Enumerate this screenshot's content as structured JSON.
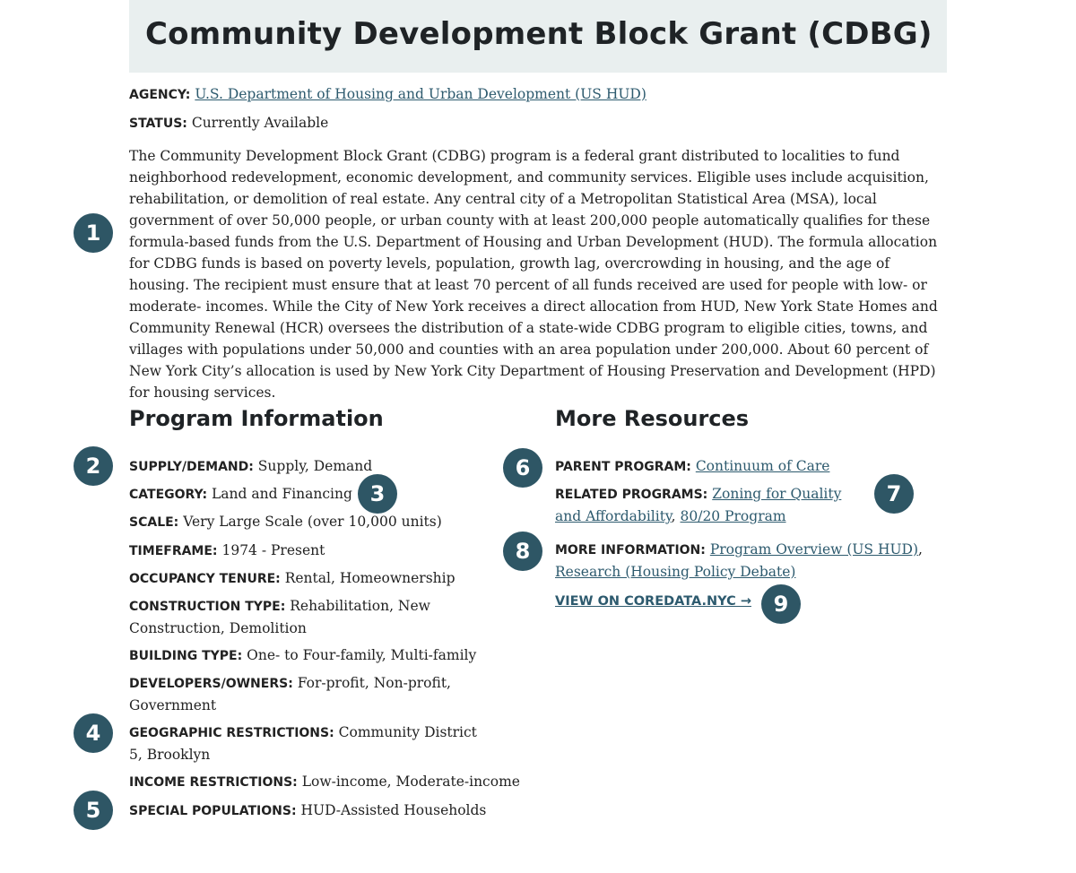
{
  "title": "Community Development Block Grant (CDBG)",
  "agency": {
    "label": "AGENCY:",
    "value": "U.S. Department of Housing and Urban Development (US HUD)"
  },
  "status": {
    "label": "STATUS:",
    "value": "Currently Available"
  },
  "description": "The Community Development Block Grant (CDBG) program is a federal grant distributed to localities to fund neighborhood redevelopment, economic development, and community services. Eligible uses include acquisition, rehabilitation, or demolition of real estate. Any central city of a Metropolitan Statistical Area (MSA), local government of over 50,000 people, or urban county with at least 200,000 people automatically qualifies for these formula-based funds from the U.S. Department of Housing and Urban Development (HUD). The formula allocation for CDBG funds is based on poverty levels, population, growth lag, overcrowding in housing, and the age of housing. The recipient must ensure that at least 70 percent of all funds received are used for people with low- or moderate- incomes. While the City of New York receives a direct allocation from HUD, New York State Homes and Community Renewal (HCR) oversees the distribution of a state-wide CDBG program to eligible cities, towns, and villages with populations under 50,000 and counties with an area population under 200,000. About 60 percent of New York City’s allocation is used by New York City Department of Housing Preservation and Development (HPD) for housing services.",
  "program_info": {
    "heading": "Program Information",
    "supply": {
      "label": "SUPPLY/DEMAND:",
      "value": "Supply, Demand"
    },
    "category": {
      "label": "CATEGORY:",
      "value": "Land and Financing"
    },
    "scale": {
      "label": "SCALE:",
      "value": "Very Large Scale (over 10,000 units)"
    },
    "timeframe": {
      "label": "TIMEFRAME:",
      "value": "1974 - Present"
    },
    "tenure": {
      "label": "OCCUPANCY TENURE:",
      "value": "Rental, Homeownership"
    },
    "construction": {
      "label": "CONSTRUCTION TYPE:",
      "value": "Rehabilitation, New Construction, Demolition"
    },
    "building": {
      "label": "BUILDING TYPE:",
      "value": "One- to Four-family, Multi-family"
    },
    "developers": {
      "label": "DEVELOPERS/OWNERS:",
      "value": "For-profit, Non-profit, Government"
    },
    "geographic": {
      "label": "GEOGRAPHIC RESTRICTIONS:",
      "value": "Community District 5, Brooklyn"
    },
    "income": {
      "label": "INCOME RESTRICTIONS:",
      "value": "Low-income, Moderate-income"
    },
    "special": {
      "label": "SPECIAL POPULATIONS:",
      "value": "HUD-Assisted Households"
    }
  },
  "resources": {
    "heading": "More Resources",
    "parent": {
      "label": "PARENT PROGRAM:",
      "link": "Continuum of Care"
    },
    "related": {
      "label": "RELATED PROGRAMS:",
      "link1": "Zoning for Quality and Affordability",
      "sep": ", ",
      "link2": "80/20 Program"
    },
    "more_info": {
      "label": "MORE INFORMATION:",
      "link1": "Program Overview (US HUD)",
      "sep": ", ",
      "link2": "Research (Housing Policy Debate)"
    },
    "view_link": "VIEW ON COREDATA.NYC →"
  },
  "badges": [
    "1",
    "2",
    "3",
    "4",
    "5",
    "6",
    "7",
    "8",
    "9"
  ],
  "colors": {
    "badge": "#2e5665",
    "link": "#2d5a6e",
    "title_bg": "#e9efef"
  }
}
